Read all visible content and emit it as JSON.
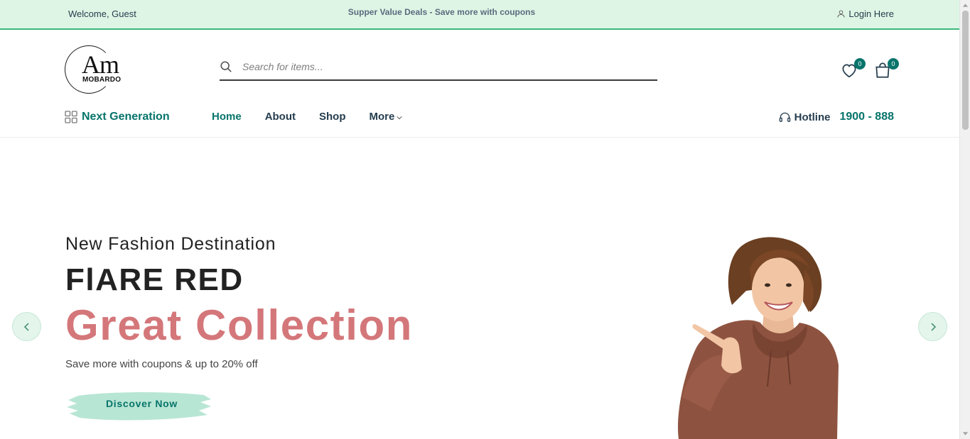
{
  "topbar": {
    "welcome": "Welcome, Guest",
    "promo": "Supper Value Deals - Save more with coupons",
    "login": "Login Here"
  },
  "logo": {
    "monogram": "Am",
    "brand": "MOBARDO"
  },
  "search": {
    "placeholder": "Search for items..."
  },
  "header": {
    "wishlist_count": "0",
    "cart_count": "0"
  },
  "nav": {
    "category_label": "Next Generation",
    "links": [
      "Home",
      "About",
      "Shop",
      "More"
    ],
    "active": "Home",
    "hotline_label": "Hotline",
    "hotline_number": "1900 - 888"
  },
  "hero": {
    "subtitle": "New Fashion Destination",
    "title": "FlARE RED",
    "accent": "Great Collection",
    "description": "Save more with coupons & up to 20% off",
    "cta": "Discover Now"
  },
  "colors": {
    "accent": "#07746b",
    "topbar_bg": "#def5e5",
    "hero_accent": "#d4777a",
    "cta_brush": "#b8e6d4"
  },
  "icons": [
    "user-icon",
    "search-icon",
    "heart-icon",
    "shopping-bag-icon",
    "grid-icon",
    "chevron-down-icon",
    "headphones-icon",
    "chevron-left-icon",
    "chevron-right-icon"
  ]
}
